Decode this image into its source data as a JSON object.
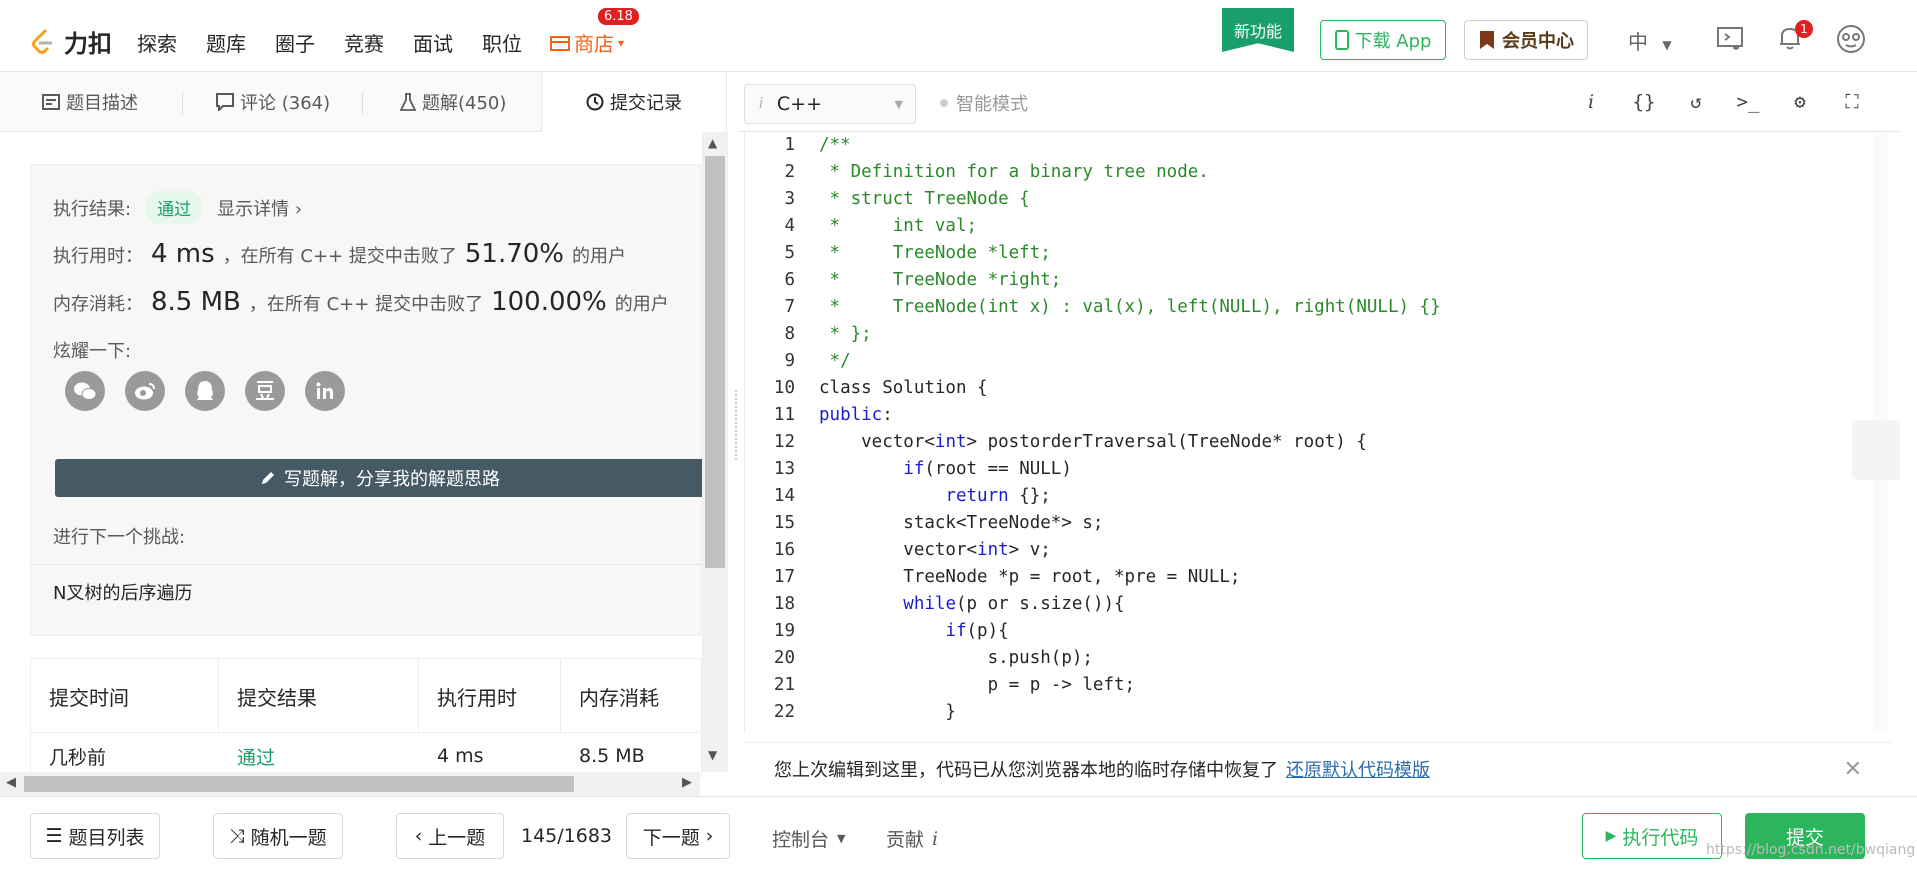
{
  "nav": {
    "logo_text": "力扣",
    "links": [
      "探索",
      "题库",
      "圈子",
      "竞赛",
      "面试",
      "职位"
    ],
    "store_label": "商店",
    "store_badge": "6.18",
    "new_feature": "新功能",
    "download_app": "下载 App",
    "vip_center": "会员中心",
    "lang": "中",
    "notif_count": "1"
  },
  "left_tabs": [
    {
      "label": "题目描述",
      "icon": "description-icon"
    },
    {
      "label": "评论 (364)",
      "icon": "comment-icon"
    },
    {
      "label": "题解(450)",
      "icon": "flask-icon"
    },
    {
      "label": "提交记录",
      "icon": "clock-icon"
    }
  ],
  "result": {
    "exec_label": "执行结果:",
    "status": "通过",
    "details": "显示详情",
    "time_label": "执行用时：",
    "time_value": "4 ms",
    "time_mid": "，在所有 C++ 提交中击败了",
    "time_pct": "51.70%",
    "time_suffix": "的用户",
    "mem_label": "内存消耗：",
    "mem_value": "8.5 MB",
    "mem_mid": "，在所有 C++ 提交中击败了",
    "mem_pct": "100.00%",
    "mem_suffix": "的用户",
    "share_label": "炫耀一下:",
    "share_icons": [
      "wechat-icon",
      "weibo-icon",
      "qq-icon",
      "douban-icon",
      "linkedin-icon"
    ],
    "write_solution": "写题解，分享我的解题思路",
    "next_challenge_label": "进行下一个挑战:",
    "next_challenge": "N叉树的后序遍历"
  },
  "submissions": {
    "headers": [
      "提交时间",
      "提交结果",
      "执行用时",
      "内存消耗"
    ],
    "rows": [
      {
        "time": "几秒前",
        "result": "通过",
        "runtime": "4 ms",
        "memory": "8.5 MB"
      }
    ]
  },
  "bottom": {
    "problem_list": "题目列表",
    "random": "随机一题",
    "prev": "上一题",
    "page": "145/1683",
    "next": "下一题",
    "console": "控制台",
    "contribute": "贡献",
    "run": "执行代码",
    "submit": "提交"
  },
  "editor": {
    "language": "C++",
    "smart_mode": "智能模式",
    "lines": [
      "/**",
      " * Definition for a binary tree node.",
      " * struct TreeNode {",
      " *     int val;",
      " *     TreeNode *left;",
      " *     TreeNode *right;",
      " *     TreeNode(int x) : val(x), left(NULL), right(NULL) {}",
      " * };",
      " */",
      "class Solution {",
      "public:",
      "    vector<int> postorderTraversal(TreeNode* root) {",
      "        if(root == NULL)",
      "            return {};",
      "        stack<TreeNode*> s;",
      "        vector<int> v;",
      "        TreeNode *p = root, *pre = NULL;",
      "        while(p or s.size()){",
      "            if(p){",
      "                s.push(p);",
      "                p = p -> left;",
      "            }"
    ],
    "restore_msg": "您上次编辑到这里，代码已从您浏览器本地的临时存储中恢复了",
    "restore_link": "还原默认代码模版"
  },
  "watermark": "https://blog.csdn.net/bwqiang",
  "colors": {
    "accent": "#2db55d",
    "store": "#f0631a",
    "comment": "#2a8a2a",
    "keyword": "#1b1bd1"
  }
}
